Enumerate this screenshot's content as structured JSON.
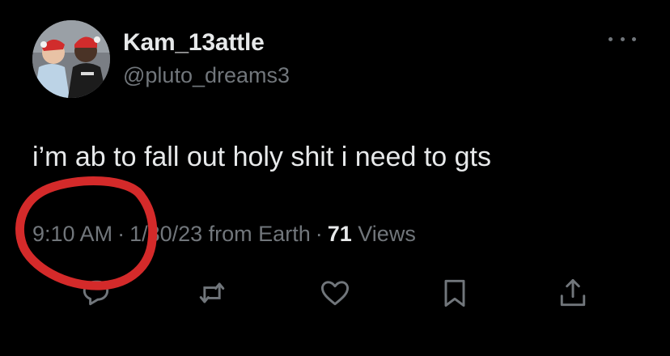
{
  "colors": {
    "background": "#000000",
    "primary_text": "#e7e9ea",
    "secondary_text": "#71767b",
    "annotation": "#d42a2a"
  },
  "author": {
    "display_name": "Kam_13attle",
    "handle": "@pluto_dreams3"
  },
  "tweet": {
    "text": "i’m ab to fall out holy shit i need to gts"
  },
  "meta": {
    "time": "9:10 AM",
    "dot1": "·",
    "date": "1/30/23",
    "source": "from Earth",
    "dot2": "·",
    "views_count": "71",
    "views_label": "Views"
  },
  "icons": {
    "more": "more-horizontal-icon",
    "reply": "reply-icon",
    "retweet": "retweet-icon",
    "like": "heart-icon",
    "bookmark": "bookmark-icon",
    "share": "share-icon"
  }
}
